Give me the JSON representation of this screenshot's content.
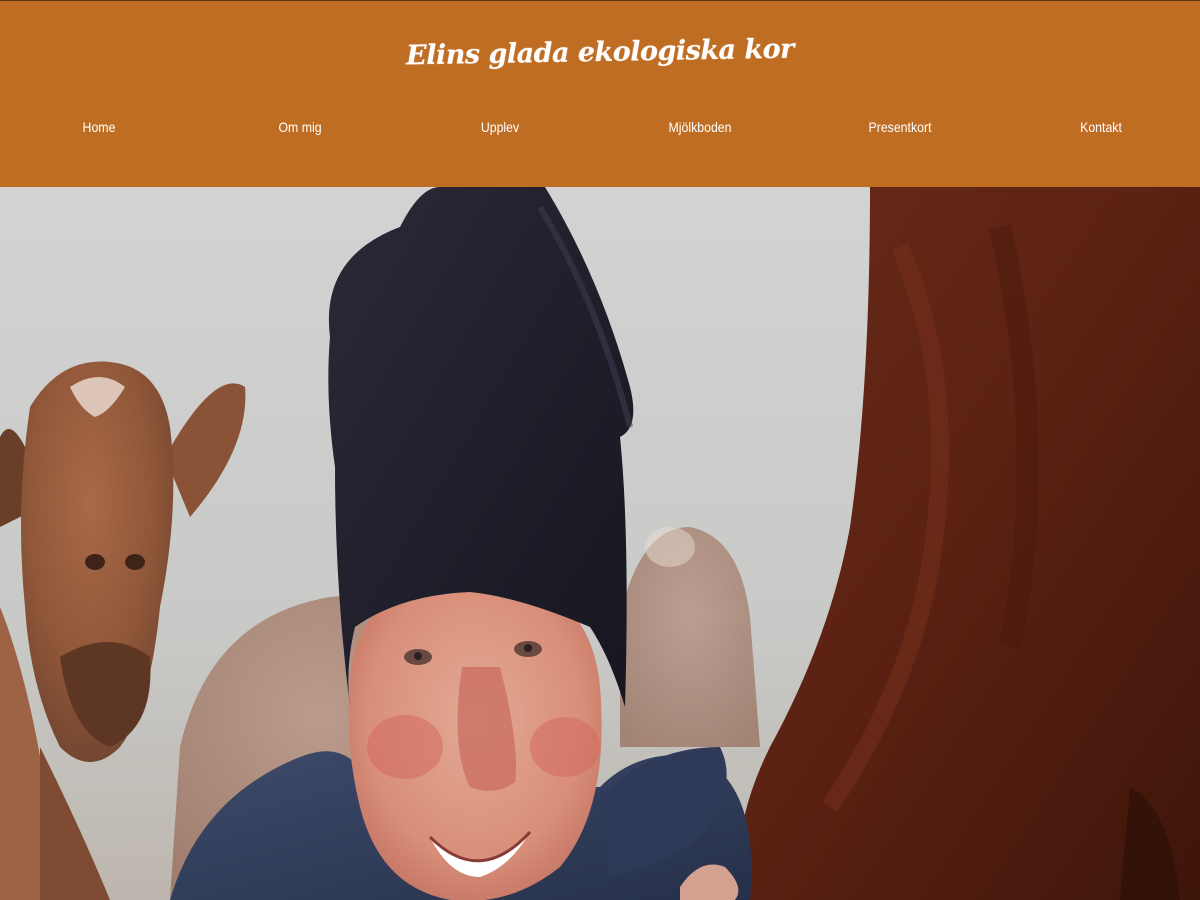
{
  "header": {
    "title": "Elins glada ekologiska kor",
    "background_color": "#c06d24",
    "text_color": "#ffffff"
  },
  "nav": {
    "items": [
      {
        "label": "Home"
      },
      {
        "label": "Om mig"
      },
      {
        "label": "Upplev"
      },
      {
        "label": "Mjölkboden"
      },
      {
        "label": "Presentkort"
      },
      {
        "label": "Kontakt"
      }
    ]
  },
  "hero": {
    "image_subject": "farmer-with-cows-photo"
  }
}
